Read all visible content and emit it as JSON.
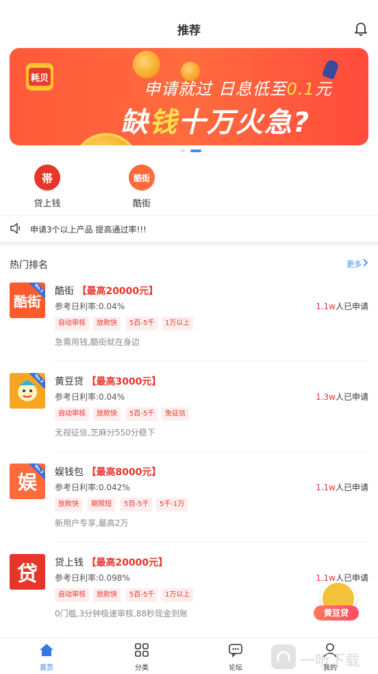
{
  "header": {
    "title": "推荐"
  },
  "banner": {
    "logo_text": "耗贝",
    "line1_a": "申请就过 日息低至",
    "line1_hi": "0.1",
    "line1_b": "元",
    "line2_a": "缺",
    "line2_hi": "钱",
    "line2_b": "十万火急?",
    "coin_symbol": "¥"
  },
  "quick_links": [
    {
      "label": "贷上钱",
      "icon_text": "帯"
    },
    {
      "label": "酷街",
      "icon_text": "酷街"
    }
  ],
  "notice": {
    "text": "申请3个以上产品 提高通过率!!!"
  },
  "section": {
    "title": "热门排名",
    "more": "更多"
  },
  "products": [
    {
      "name": "酷街",
      "amount": "【最高20000元】",
      "rate": "参考日利率:0.04%",
      "tags": [
        "自动审核",
        "放款快",
        "5百-5千",
        "1万以上"
      ],
      "desc": "急需用钱,酷街就在身边",
      "applied_num": "1.1w",
      "applied_text": "人已申请",
      "thumb_text": "酷街",
      "badge": "No.1",
      "thumb_color": "#ff5a2e"
    },
    {
      "name": "黄豆贷",
      "amount": "【最高3000元】",
      "rate": "参考日利率:0.04%",
      "tags": [
        "自动审核",
        "放款快",
        "5百-5千",
        "免征信"
      ],
      "desc": "无视征信,芝麻分550分稳下",
      "applied_num": "1.3w",
      "applied_text": "人已申请",
      "thumb_text": "",
      "badge": "No.2",
      "thumb_color": "#f6a623"
    },
    {
      "name": "娱钱包",
      "amount": "【最高8000元】",
      "rate": "参考日利率:0.042%",
      "tags": [
        "放款快",
        "期限短",
        "5百-5千",
        "5千-1万"
      ],
      "desc": "新用户专享,最高2万",
      "applied_num": "1.1w",
      "applied_text": "人已申请",
      "thumb_text": "娱",
      "badge": "No.3",
      "thumb_color": "#ff6a3a"
    },
    {
      "name": "贷上钱",
      "amount": "【最高20000元】",
      "rate": "参考日利率:0.098%",
      "tags": [
        "自动审核",
        "放款快",
        "5百-5千",
        "1万以上"
      ],
      "desc": "0门槛,3分钟极速审核,88秒现金到账",
      "applied_num": "1.1w",
      "applied_text": "人已申请",
      "thumb_text": "贷",
      "badge": "",
      "thumb_color": "#e8352a"
    }
  ],
  "floater": {
    "label": "黄豆贷"
  },
  "nav": [
    {
      "label": "首页",
      "icon": "home-icon"
    },
    {
      "label": "分类",
      "icon": "grid-icon"
    },
    {
      "label": "论坛",
      "icon": "chat-icon"
    },
    {
      "label": "我的",
      "icon": "user-icon"
    }
  ],
  "watermark": {
    "text": "一听下载"
  },
  "colors": {
    "accent": "#2f7ae5",
    "red": "#e8352a"
  }
}
